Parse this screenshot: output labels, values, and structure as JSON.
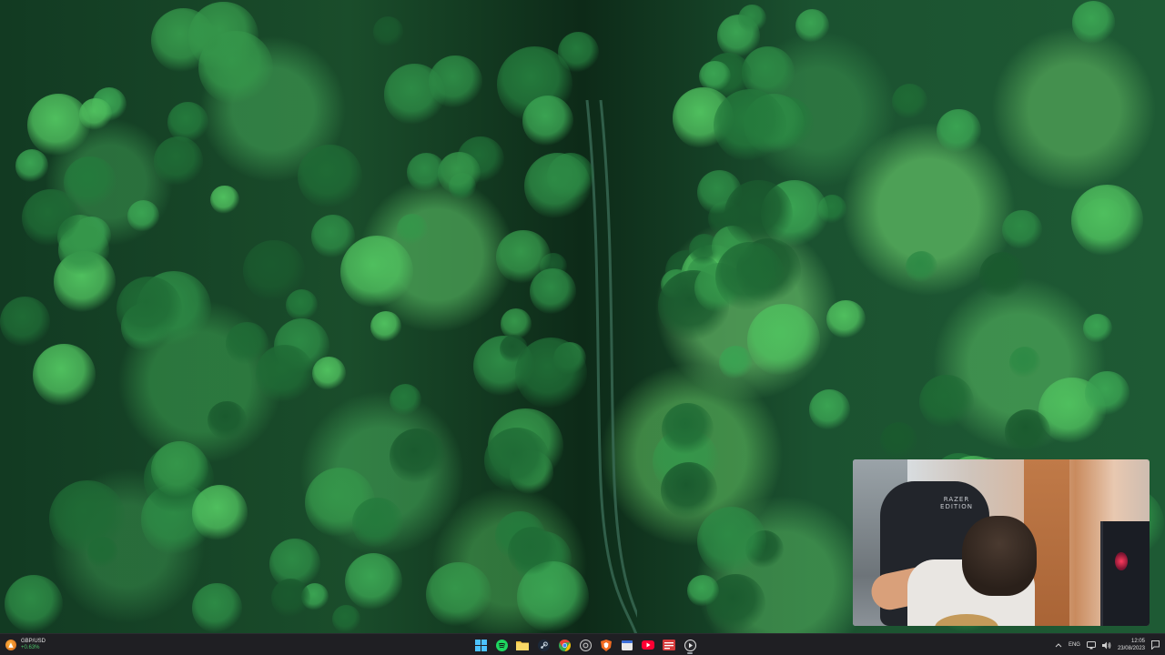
{
  "widget": {
    "ticker": "GBP/USD",
    "change": "+0.63%",
    "icon": "flame-widget-icon",
    "change_color": "#4ec46a"
  },
  "webcam": {
    "chair_brand_line1": "RAZER",
    "chair_brand_line2": "EDITION"
  },
  "taskbar": {
    "apps": [
      {
        "name": "start",
        "icon": "windows-logo-icon",
        "color": "#4cc2ff",
        "active": false
      },
      {
        "name": "spotify",
        "icon": "spotify-icon",
        "color": "#1ed760",
        "active": false
      },
      {
        "name": "file-explorer",
        "icon": "folder-icon",
        "color": "#f4c542",
        "active": false
      },
      {
        "name": "steam",
        "icon": "steam-icon",
        "color": "#c7d5e0",
        "active": false
      },
      {
        "name": "chrome",
        "icon": "chrome-icon",
        "color": "#e94235",
        "active": false
      },
      {
        "name": "obs",
        "icon": "camera-app-icon",
        "color": "#cfcfcf",
        "active": false
      },
      {
        "name": "brave",
        "icon": "shield-browser-icon",
        "color": "#f26b21",
        "active": false
      },
      {
        "name": "calendar",
        "icon": "calendar-icon",
        "color": "#e8e8e8",
        "active": false
      },
      {
        "name": "youtube",
        "icon": "youtube-icon",
        "color": "#ff0033",
        "active": false
      },
      {
        "name": "recorder",
        "icon": "recorder-icon",
        "color": "#d63a3a",
        "active": false
      },
      {
        "name": "media-player",
        "icon": "play-circle-icon",
        "color": "#ffffff",
        "active": true
      }
    ]
  },
  "tray": {
    "language": "ENG",
    "time": "12:05",
    "date": "23/08/2023"
  }
}
